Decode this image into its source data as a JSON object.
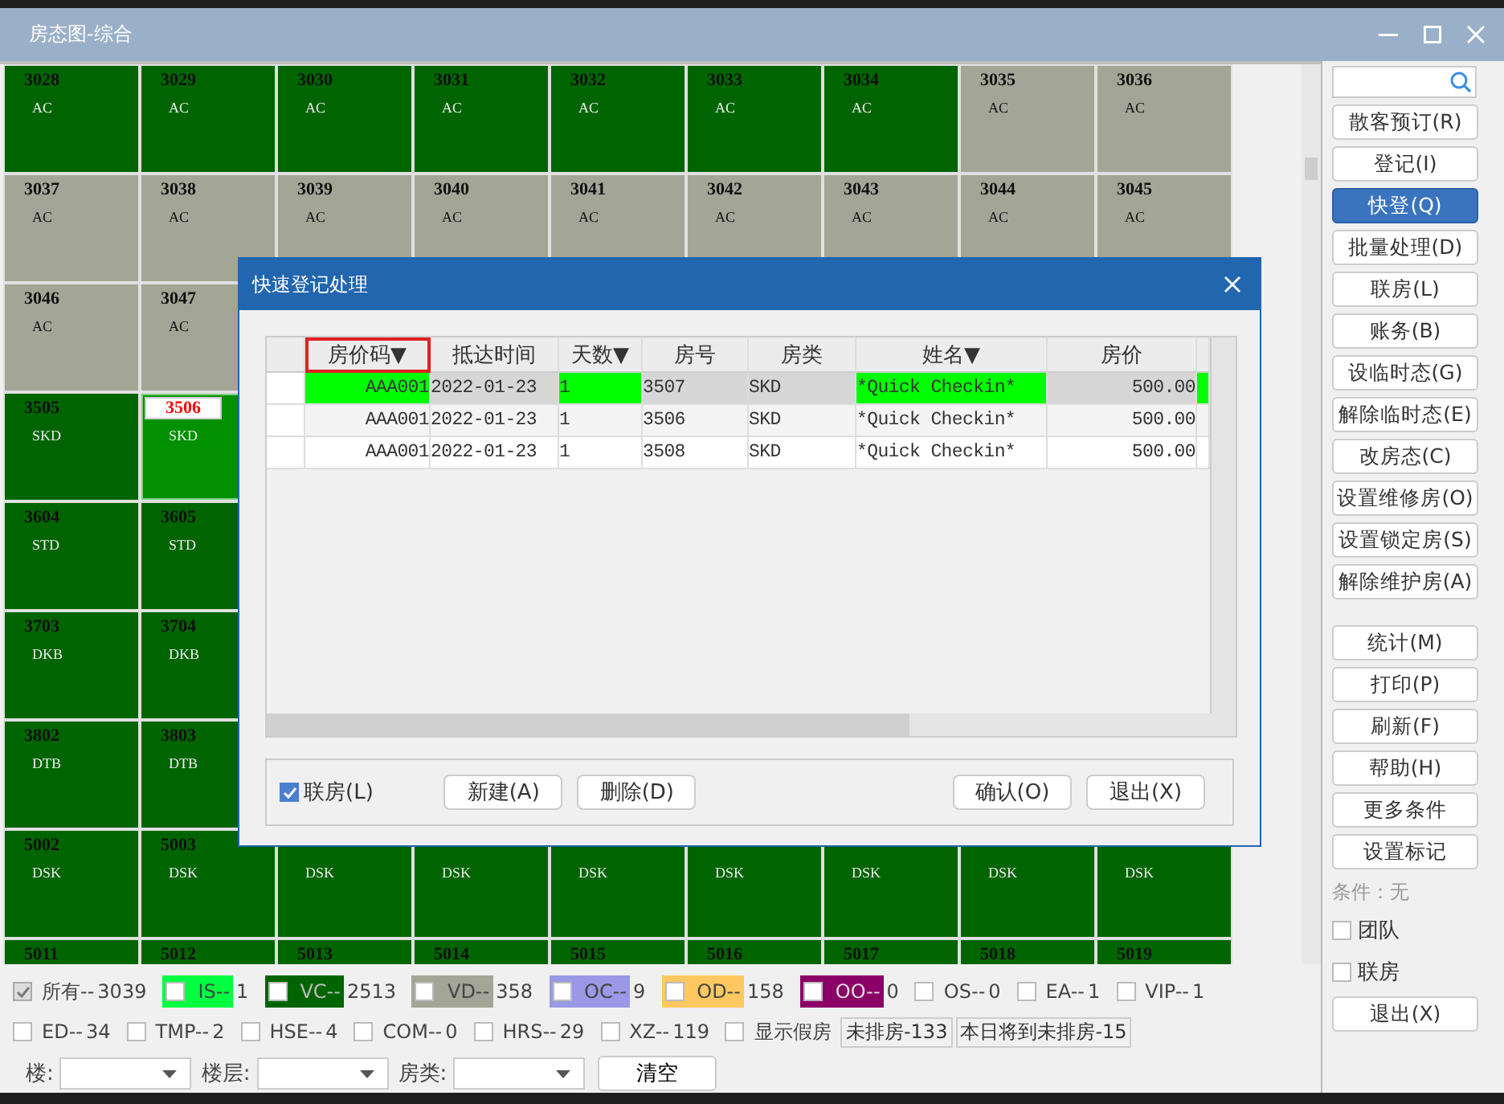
{
  "window": {
    "title": "房态图-综合"
  },
  "room_rows": [
    {
      "cells": [
        {
          "number": "3028",
          "type": "AC",
          "color": "#006400",
          "selected": false
        },
        {
          "number": "3029",
          "type": "AC",
          "color": "#006400",
          "selected": false
        },
        {
          "number": "3030",
          "type": "AC",
          "color": "#006400",
          "selected": false
        },
        {
          "number": "3031",
          "type": "AC",
          "color": "#006400",
          "selected": false
        },
        {
          "number": "3032",
          "type": "AC",
          "color": "#006400",
          "selected": false
        },
        {
          "number": "3033",
          "type": "AC",
          "color": "#006400",
          "selected": false
        },
        {
          "number": "3034",
          "type": "AC",
          "color": "#006400",
          "selected": false
        },
        {
          "number": "3035",
          "type": "AC",
          "color": "#a3a596",
          "selected": false
        },
        {
          "number": "3036",
          "type": "AC",
          "color": "#a3a596",
          "selected": false
        }
      ]
    },
    {
      "cells": [
        {
          "number": "3037",
          "type": "AC",
          "color": "#a3a596",
          "selected": false
        },
        {
          "number": "3038",
          "type": "AC",
          "color": "#a3a596",
          "selected": false
        },
        {
          "number": "3039",
          "type": "AC",
          "color": "#a3a596",
          "selected": false
        },
        {
          "number": "3040",
          "type": "AC",
          "color": "#a3a596",
          "selected": false
        },
        {
          "number": "3041",
          "type": "AC",
          "color": "#a3a596",
          "selected": false
        },
        {
          "number": "3042",
          "type": "AC",
          "color": "#a3a596",
          "selected": false
        },
        {
          "number": "3043",
          "type": "AC",
          "color": "#a3a596",
          "selected": false
        },
        {
          "number": "3044",
          "type": "AC",
          "color": "#a3a596",
          "selected": false
        },
        {
          "number": "3045",
          "type": "AC",
          "color": "#a3a596",
          "selected": false
        }
      ]
    },
    {
      "cells": [
        {
          "number": "3046",
          "type": "AC",
          "color": "#a3a596",
          "selected": false
        },
        {
          "number": "3047",
          "type": "AC",
          "color": "#a3a596",
          "selected": false
        }
      ]
    },
    {
      "cells": [
        {
          "number": "3505",
          "type": "SKD",
          "color": "#006400",
          "selected": false
        },
        {
          "number": "3506",
          "type": "SKD",
          "color": "#009000",
          "selected": true
        }
      ]
    },
    {
      "cells": [
        {
          "number": "3604",
          "type": "STD",
          "color": "#006400",
          "selected": false
        },
        {
          "number": "3605",
          "type": "STD",
          "color": "#006400",
          "selected": false
        }
      ]
    },
    {
      "cells": [
        {
          "number": "3703",
          "type": "DKB",
          "color": "#006400",
          "selected": false
        },
        {
          "number": "3704",
          "type": "DKB",
          "color": "#006400",
          "selected": false
        }
      ]
    },
    {
      "cells": [
        {
          "number": "3802",
          "type": "DTB",
          "color": "#006400",
          "selected": false
        },
        {
          "number": "3803",
          "type": "DTB",
          "color": "#006400",
          "selected": false
        }
      ]
    },
    {
      "cells": [
        {
          "number": "5002",
          "type": "DSK",
          "color": "#006400",
          "selected": false
        },
        {
          "number": "5003",
          "type": "DSK",
          "color": "#006400",
          "selected": false
        },
        {
          "type": "DSK",
          "color": "#006400",
          "selected": false
        },
        {
          "type": "DSK",
          "color": "#006400",
          "selected": false
        },
        {
          "type": "DSK",
          "color": "#006400",
          "selected": false
        },
        {
          "type": "DSK",
          "color": "#006400",
          "selected": false
        },
        {
          "type": "DSK",
          "color": "#006400",
          "selected": false
        },
        {
          "type": "DSK",
          "color": "#006400",
          "selected": false
        },
        {
          "type": "DSK",
          "color": "#006400",
          "selected": false
        }
      ]
    },
    {
      "cells": [
        {
          "number": "5011",
          "color": "#006400",
          "selected": false
        },
        {
          "number": "5012",
          "color": "#006400",
          "selected": false
        },
        {
          "number": "5013",
          "color": "#006400",
          "selected": false
        },
        {
          "number": "5014",
          "color": "#006400",
          "selected": false
        },
        {
          "number": "5015",
          "color": "#006400",
          "selected": false
        },
        {
          "number": "5016",
          "color": "#006400",
          "selected": false
        },
        {
          "number": "5017",
          "color": "#006400",
          "selected": false
        },
        {
          "number": "5018",
          "color": "#006400",
          "selected": false
        },
        {
          "number": "5019",
          "color": "#006400",
          "selected": false
        }
      ]
    }
  ],
  "dialog": {
    "title": "快速登记处理",
    "columns": [
      {
        "label": "房价码▼",
        "highlighted": true
      },
      {
        "label": "抵达时间",
        "highlighted": false
      },
      {
        "label": "天数▼",
        "highlighted": false
      },
      {
        "label": "房号",
        "highlighted": false
      },
      {
        "label": "房类",
        "highlighted": false
      },
      {
        "label": "姓名▼",
        "highlighted": false
      },
      {
        "label": "房价",
        "highlighted": false
      }
    ],
    "rows": [
      {
        "selected": true,
        "cells": [
          {
            "text": "AAA001",
            "highlighted": true
          },
          {
            "text": "2022-01-23",
            "highlighted": false
          },
          {
            "text": "1",
            "highlighted": true
          },
          {
            "text": "3507",
            "highlighted": false
          },
          {
            "text": "SKD",
            "highlighted": false
          },
          {
            "text": "*Quick Checkin*",
            "highlighted": true
          },
          {
            "text": "500.00",
            "highlighted": false
          }
        ]
      },
      {
        "selected": false,
        "cells": [
          {
            "text": "AAA001",
            "highlighted": false
          },
          {
            "text": "2022-01-23",
            "highlighted": false
          },
          {
            "text": "1",
            "highlighted": false
          },
          {
            "text": "3506",
            "highlighted": false
          },
          {
            "text": "SKD",
            "highlighted": false
          },
          {
            "text": "*Quick Checkin*",
            "highlighted": false
          },
          {
            "text": "500.00",
            "highlighted": false
          }
        ]
      },
      {
        "selected": false,
        "cells": [
          {
            "text": "AAA001",
            "highlighted": false
          },
          {
            "text": "2022-01-23",
            "highlighted": false
          },
          {
            "text": "1",
            "highlighted": false
          },
          {
            "text": "3508",
            "highlighted": false
          },
          {
            "text": "SKD",
            "highlighted": false
          },
          {
            "text": "*Quick Checkin*",
            "highlighted": false
          },
          {
            "text": "500.00",
            "highlighted": false
          }
        ]
      }
    ],
    "link_rooms": {
      "label": "联房(L)",
      "checked": true
    },
    "left_buttons": [
      "新建(A)",
      "删除(D)"
    ],
    "right_buttons": [
      "确认(O)",
      "退出(X)"
    ]
  },
  "sidebar": {
    "groups": [
      [
        {
          "label": "散客预订(R)",
          "selected": false
        },
        {
          "label": "登记(I)",
          "selected": false
        },
        {
          "label": "快登(Q)",
          "selected": true
        },
        {
          "label": "批量处理(D)",
          "selected": false
        },
        {
          "label": "联房(L)",
          "selected": false
        },
        {
          "label": "账务(B)",
          "selected": false
        },
        {
          "label": "设临时态(G)",
          "selected": false
        },
        {
          "label": "解除临时态(E)",
          "selected": false
        },
        {
          "label": "改房态(C)",
          "selected": false
        },
        {
          "label": "设置维修房(O)",
          "selected": false
        },
        {
          "label": "设置锁定房(S)",
          "selected": false
        },
        {
          "label": "解除维护房(A)",
          "selected": false
        }
      ],
      [
        {
          "label": "统计(M)",
          "selected": false
        },
        {
          "label": "打印(P)",
          "selected": false
        },
        {
          "label": "刷新(F)",
          "selected": false
        },
        {
          "label": "帮助(H)",
          "selected": false
        },
        {
          "label": "更多条件",
          "selected": false
        },
        {
          "label": "设置标记",
          "selected": false
        }
      ]
    ],
    "condition": "条件：无",
    "checkboxes": [
      {
        "label": "团队",
        "checked": false
      },
      {
        "label": "联房",
        "checked": false
      }
    ],
    "exit_button": "退出(X)"
  },
  "legend": [
    [
      {
        "label": "所有--",
        "count": "3039",
        "checked": true,
        "disabled": true
      },
      {
        "label": "IS--",
        "count": "1",
        "checked": false,
        "disabled": false,
        "color": "#00ff40"
      },
      {
        "label": "VC--",
        "count": "2513",
        "checked": false,
        "disabled": false,
        "color": "#006400"
      },
      {
        "label": "VD--",
        "count": "358",
        "checked": false,
        "disabled": false,
        "color": "#a3a596"
      },
      {
        "label": "OC--",
        "count": "9",
        "checked": false,
        "disabled": false,
        "color": "#9999e6"
      },
      {
        "label": "OD--",
        "count": "158",
        "checked": false,
        "disabled": false,
        "color": "#ffc860"
      },
      {
        "label": "OO--",
        "count": "0",
        "checked": false,
        "disabled": false,
        "color": "#8b0066"
      },
      {
        "label": "OS--",
        "count": "0",
        "checked": false,
        "disabled": false
      },
      {
        "label": "EA--",
        "count": "1",
        "checked": false,
        "disabled": false
      },
      {
        "label": "VIP--",
        "count": "1",
        "checked": false,
        "disabled": false
      }
    ],
    [
      {
        "label": "ED--",
        "count": "34",
        "checked": false,
        "disabled": false
      },
      {
        "label": "TMP--",
        "count": "2",
        "checked": false,
        "disabled": false
      },
      {
        "label": "HSE--",
        "count": "4",
        "checked": false,
        "disabled": false
      },
      {
        "label": "COM--",
        "count": "0",
        "checked": false,
        "disabled": false
      },
      {
        "label": "HRS--",
        "count": "29",
        "checked": false,
        "disabled": false
      },
      {
        "label": "XZ--",
        "count": "119",
        "checked": false,
        "disabled": false
      }
    ]
  ],
  "show_fake_rooms": {
    "label": "显示假房",
    "checked": false
  },
  "unassigned": [
    "未排房-133",
    "本日将到未排房-15"
  ],
  "filters": [
    {
      "label": "楼:"
    },
    {
      "label": "楼层:"
    },
    {
      "label": "房类:"
    }
  ],
  "clear_button": "清空"
}
